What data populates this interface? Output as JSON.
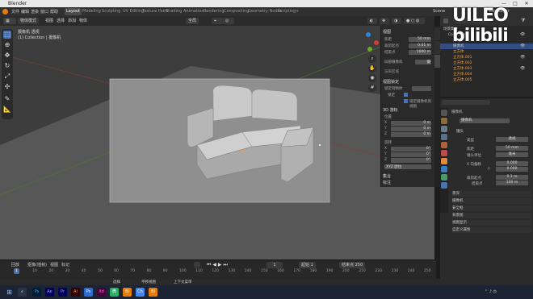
{
  "window": {
    "title": "Blender",
    "min": "—",
    "max": "□",
    "close": "✕"
  },
  "menubar": {
    "items": [
      "文件",
      "编辑",
      "渲染",
      "窗口",
      "帮助"
    ],
    "workspaces": [
      "Layout",
      "Modeling",
      "Sculpting",
      "UV Editing",
      "Texture Paint",
      "Shading",
      "Animation",
      "Rendering",
      "Compositing",
      "Geometry Nodes",
      "Scripting",
      "+"
    ],
    "scene_label": "Scene",
    "view_layer_label": "ViewLayer"
  },
  "viewport_header": {
    "mode": "物体模式",
    "view": "视图",
    "select": "选择",
    "add": "添加",
    "object": "物体",
    "transform": "全局"
  },
  "camera_overlay": {
    "title": "摄像机 透视",
    "collection": "(1) Collection | 摄像机"
  },
  "npanel": {
    "camera_section": "视图",
    "rows": [
      {
        "label": "焦距",
        "value": "50 mm"
      },
      {
        "label": "裁剪起点",
        "value": "0.01 m"
      },
      {
        "label": "结束点",
        "value": "1000 m"
      }
    ],
    "local_camera": "局部摄像机",
    "camera_value": "摄",
    "render_region": "渲染区域",
    "view_lock": "视图锁定",
    "lock_to_object": "锁定到物体",
    "lock_3d_cursor": "锁定",
    "lock_camera_to_view": "锁定摄像机到视图",
    "cursor_section": "3D 游标",
    "location_label": "位置",
    "loc": [
      {
        "axis": "X",
        "value": "0 m"
      },
      {
        "axis": "Y",
        "value": "0 m"
      },
      {
        "axis": "Z",
        "value": "0 m"
      }
    ],
    "rotation_label": "旋转",
    "rot": [
      {
        "axis": "X",
        "value": "0°"
      },
      {
        "axis": "Y",
        "value": "0°"
      },
      {
        "axis": "Z",
        "value": "0°"
      }
    ],
    "rotation_mode": "XYZ 欧拉",
    "collections_section": "集合",
    "annotations_section": "标注",
    "tabs": [
      "条目",
      "工具",
      "视图"
    ]
  },
  "outliner": {
    "rows": [
      {
        "label": "场景集合",
        "selected": false
      },
      {
        "label": "Collection",
        "selected": false
      },
      {
        "label": "灯光",
        "selected": false
      },
      {
        "label": "摄像机",
        "selected": true
      },
      {
        "label": "立方体",
        "selected": false
      },
      {
        "label": "立方体.001",
        "selected": false
      },
      {
        "label": "立方体.002",
        "selected": false
      },
      {
        "label": "立方体.003",
        "selected": false
      },
      {
        "label": "立方体.004",
        "selected": false
      },
      {
        "label": "立方体.005",
        "selected": false
      }
    ]
  },
  "properties": {
    "breadcrumb_object": "摄像机",
    "data_name": "摄像机",
    "lens_section": "镜头",
    "fields": [
      {
        "label": "类型",
        "value": "透视"
      },
      {
        "label": "焦距",
        "value": "50 mm"
      },
      {
        "label": "镜头单位",
        "value": "毫米"
      },
      {
        "label": "X 向偏移",
        "value": "0.000"
      },
      {
        "label": "Y",
        "value": "0.000"
      },
      {
        "label": "裁剪起点",
        "value": "0.1 m"
      },
      {
        "label": "结束点",
        "value": "100 m"
      }
    ],
    "sections": [
      "景深",
      "摄像机",
      "安全框",
      "背景图",
      "视图显示",
      "自定义属性"
    ]
  },
  "timeline": {
    "menu": [
      "回放",
      "抠像(插帧)",
      "视图",
      "标记"
    ],
    "current_frame": "1",
    "start_label": "起始",
    "start": "1",
    "end_label": "结束点",
    "end": "250",
    "ticks": [
      "0",
      "10",
      "20",
      "30",
      "40",
      "50",
      "60",
      "70",
      "80",
      "90",
      "100",
      "110",
      "120",
      "130",
      "140",
      "150",
      "160",
      "170",
      "180",
      "190",
      "200",
      "210",
      "220",
      "230",
      "240",
      "250"
    ]
  },
  "statusbar": {
    "left": "选择",
    "mid": "平移视图",
    "right": "上下文菜单"
  },
  "taskbar": {
    "icons": [
      "Ps",
      "Ae",
      "Pr",
      "Ai",
      "Ps",
      "Xd",
      "微",
      "Bl",
      "Ch",
      "Bl"
    ]
  },
  "watermark": "UILEO bilibili",
  "colors": {
    "accent": "#4772b3",
    "selected_row": "#334d80",
    "viewport_bg": "#3d3d3d",
    "camera_area": "#8e8e8e"
  }
}
